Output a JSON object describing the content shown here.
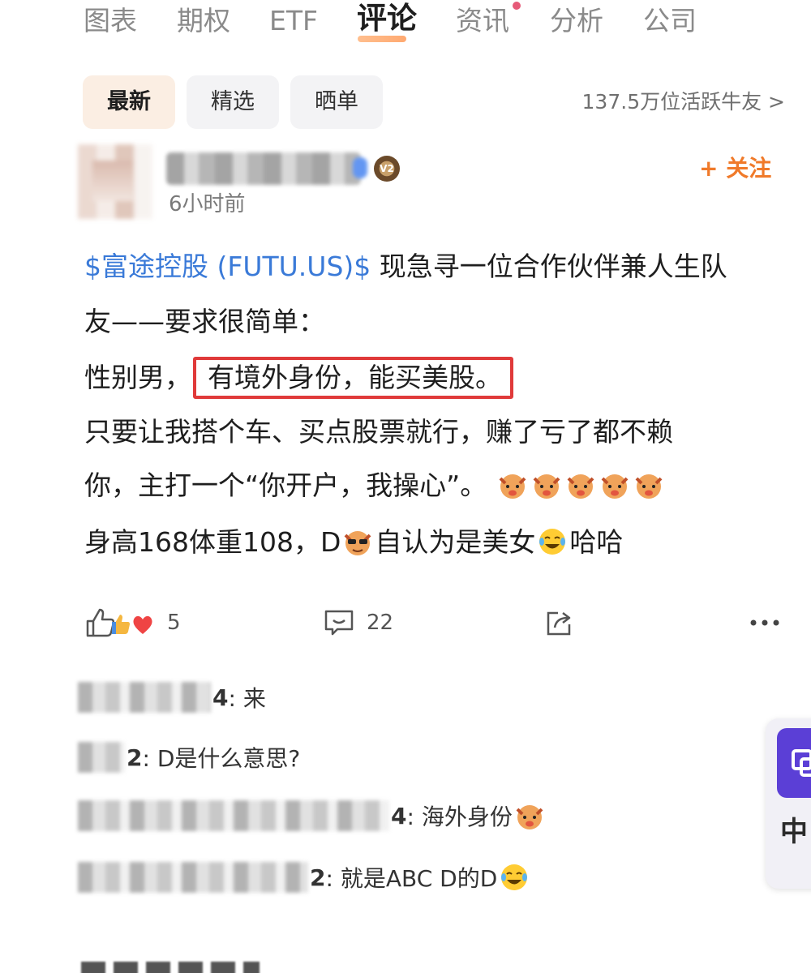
{
  "tabs": {
    "items": [
      {
        "label": "图表"
      },
      {
        "label": "期权"
      },
      {
        "label": "ETF"
      },
      {
        "label": "评论"
      },
      {
        "label": "资讯"
      },
      {
        "label": "分析"
      },
      {
        "label": "公司"
      }
    ],
    "active": "评论"
  },
  "filters": {
    "items": [
      {
        "label": "最新"
      },
      {
        "label": "精选"
      },
      {
        "label": "晒单"
      }
    ],
    "active": "最新",
    "active_users": "137.5万位活跃牛友 >"
  },
  "post": {
    "author_level_badge": "V2",
    "time": "6小时前",
    "follow_label": "+ 关注",
    "stock_link": "$富途控股 (FUTU.US)$",
    "line1_rest": " 现急寻一位合作伙伴兼人生队",
    "line2": "友——要求很简单：",
    "line3_prefix": "性别男，",
    "line3_highlight": "有境外身份，能买美股。",
    "line4": "只要让我搭个车、买点股票就行，赚了亏了都不赖",
    "line5": "你，主打一个“你开户，我操心”。",
    "line6_a": "身高168体重108，D",
    "line6_b": "自认为是美女",
    "line6_c": "哈哈",
    "likes": "5",
    "comments": "22"
  },
  "comments": [
    {
      "name_suffix": "4",
      "text": ": 来"
    },
    {
      "name_suffix": "2",
      "text": ": D是什么意思?"
    },
    {
      "name_suffix": "4",
      "text": ": 海外身份"
    },
    {
      "name_suffix": "2",
      "text": ": 就是ABC D的D"
    }
  ],
  "floating": {
    "bottom_glyph": "中"
  },
  "colors": {
    "accent": "#f07a2a",
    "link": "#3a7ad8",
    "highlight_border": "#e03a3a",
    "floating_button": "#5b3fd6"
  }
}
